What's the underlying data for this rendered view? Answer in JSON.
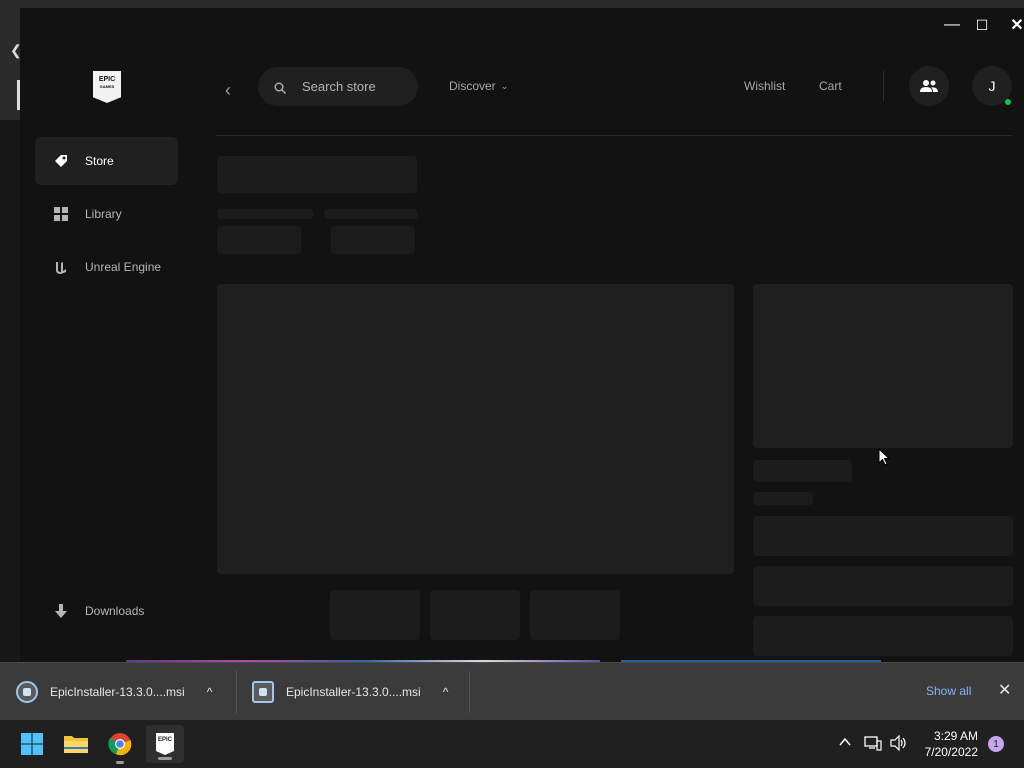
{
  "window": {
    "minimize_glyph": "—",
    "maximize_glyph": "☐",
    "close_glyph": "✕"
  },
  "logo": {
    "line1": "EPIC",
    "line2": "GAMES"
  },
  "sidebar": {
    "items": [
      {
        "label": "Store",
        "icon": "tag-icon",
        "active": true
      },
      {
        "label": "Library",
        "icon": "grid-icon",
        "active": false
      },
      {
        "label": "Unreal Engine",
        "icon": "unreal-icon",
        "active": false
      }
    ],
    "downloads_label": "Downloads"
  },
  "topbar": {
    "back_glyph": "‹",
    "search_placeholder": "Search store",
    "discover_label": "Discover",
    "discover_chevron": "⌄",
    "wishlist_label": "Wishlist",
    "cart_label": "Cart",
    "avatar_letter": "J"
  },
  "downloads_shelf": {
    "items": [
      {
        "filename": "EpicInstaller-13.3.0....msi"
      },
      {
        "filename": "EpicInstaller-13.3.0....msi"
      }
    ],
    "caret": "^",
    "show_all_label": "Show all",
    "close_glyph": "✕"
  },
  "taskbar": {
    "apps": [
      "windows-start-icon",
      "file-explorer-icon",
      "chrome-icon",
      "epic-games-icon"
    ],
    "epic_label": "EPIC",
    "time": "3:29 AM",
    "date": "7/20/2022",
    "notification_count": "1"
  },
  "colors": {
    "launcher_bg": "#121212",
    "skeleton": "#1c1c1c",
    "online": "#1fbf4a",
    "link": "#8ab4f8"
  }
}
